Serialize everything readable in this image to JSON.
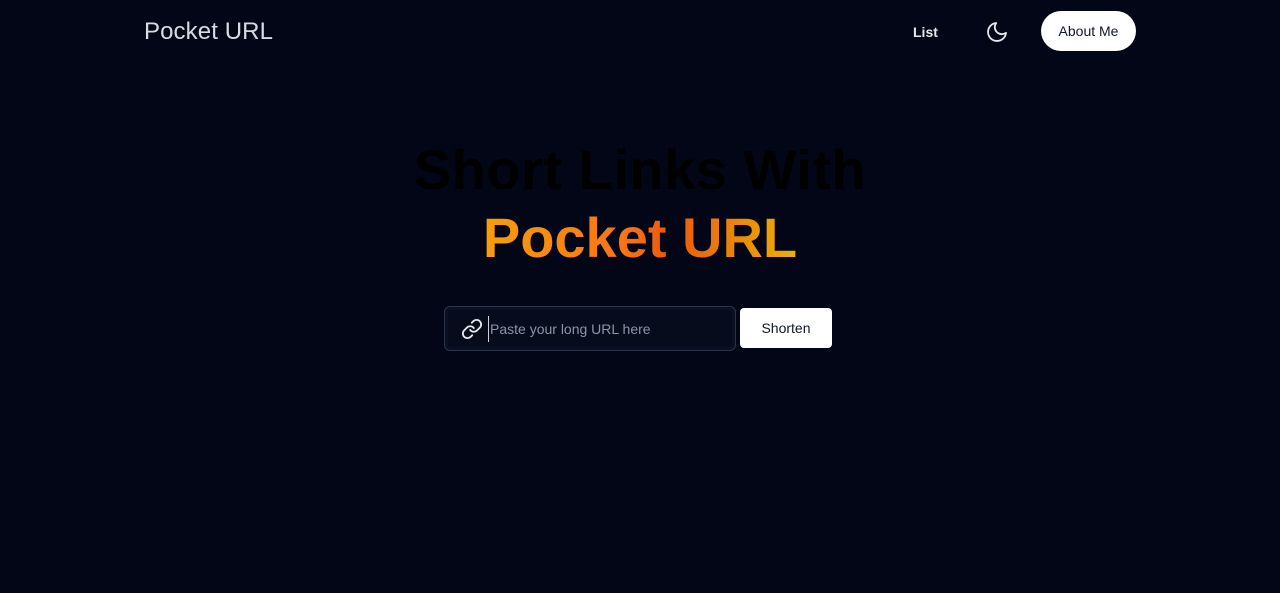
{
  "navbar": {
    "brand": "Pocket URL",
    "list_label": "List",
    "theme_icon": "moon-icon",
    "about_label": "About Me"
  },
  "hero": {
    "line1": "Short Links With",
    "line2": "Pocket URL"
  },
  "shortener": {
    "link_icon": "link-icon",
    "placeholder": "Paste your long URL here",
    "value": "",
    "button_label": "Shorten"
  },
  "colors": {
    "background": "#030616",
    "accent_gradient_start": "#f59e0b",
    "accent_gradient_mid": "#ea580c",
    "accent_gradient_end": "#eab308"
  }
}
